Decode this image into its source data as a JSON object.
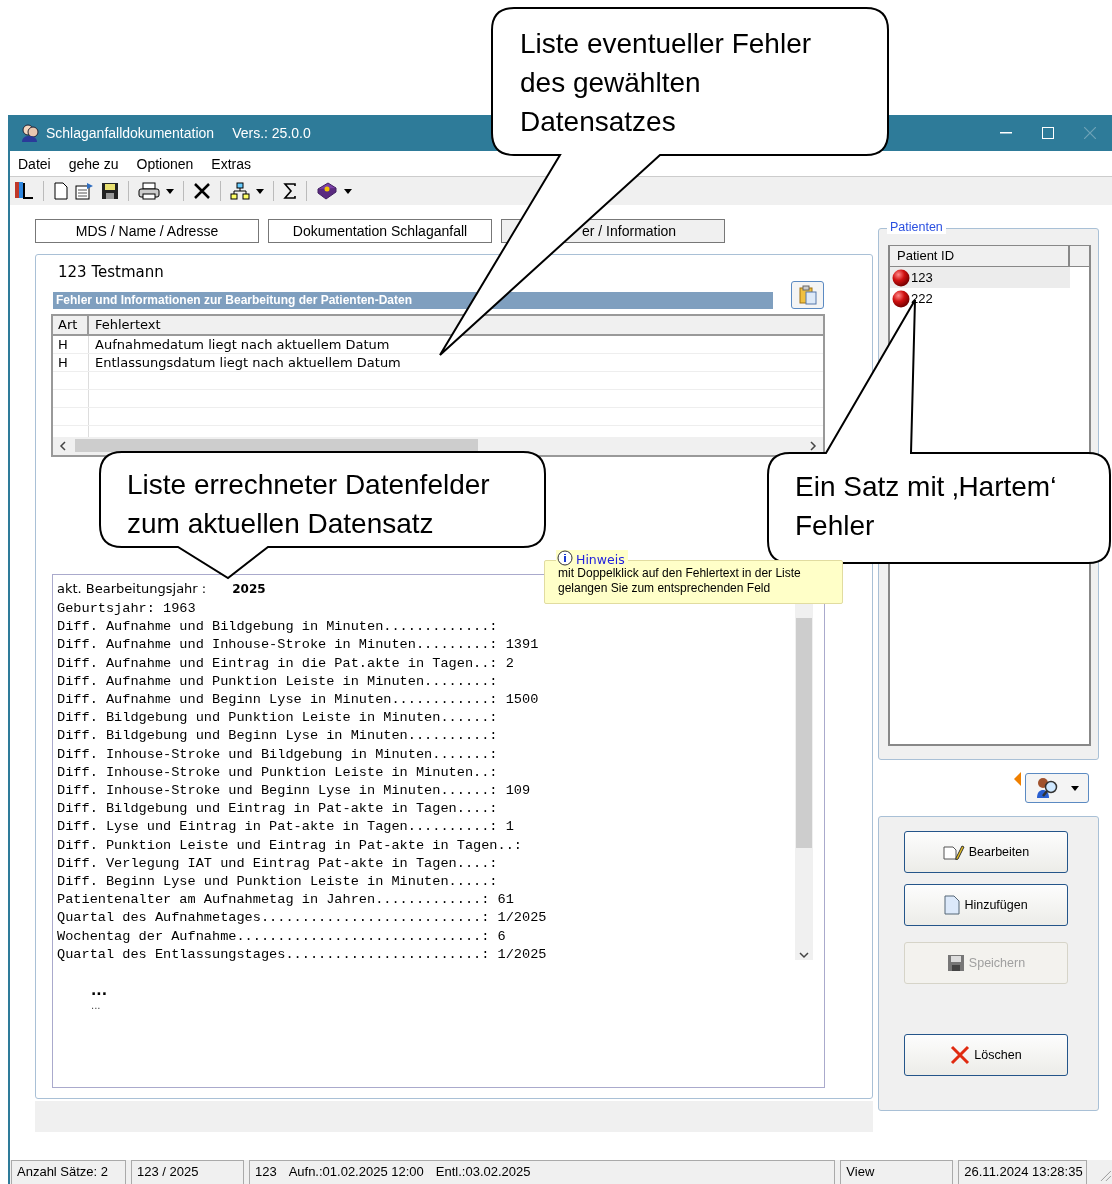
{
  "window": {
    "title": "Schlaganfalldokumentation",
    "version": "Vers.: 25.0.0"
  },
  "menu": [
    "Datei",
    "gehe zu",
    "Optionen",
    "Extras"
  ],
  "tabs": [
    {
      "label": "MDS / Name / Adresse",
      "selected": false
    },
    {
      "label": "Dokumentation Schlaganfall",
      "selected": false
    },
    {
      "label": "er / Information",
      "selected": false
    }
  ],
  "patient_header": "123 Testmann",
  "errors": {
    "title": "Fehler und Informationen zur Bearbeitung der Patienten-Daten",
    "columns": [
      "Art",
      "Fehlertext"
    ],
    "rows": [
      [
        "H",
        "Aufnahmedatum liegt nach aktuellem Datum"
      ],
      [
        "H",
        "Entlassungsdatum liegt nach aktuellem Datum"
      ]
    ]
  },
  "computed": {
    "year_label": "akt. Bearbeitungsjahr :",
    "year": "2025",
    "lines": [
      "Geburtsjahr: 1963",
      "Diff. Aufnahme und Bildgebung in Minuten.............:",
      "Diff. Aufnahme und Inhouse-Stroke in Minuten.........: 1391",
      "Diff. Aufnahme und Eintrag in die Pat.akte in Tagen..: 2",
      "Diff. Aufnahme und Punktion Leiste in Minuten........:",
      "Diff. Aufnahme und Beginn Lyse in Minuten............: 1500",
      "Diff. Bildgebung und Punktion Leiste in Minuten......:",
      "Diff. Bildgebung und Beginn Lyse in Minuten..........:",
      "Diff. Inhouse-Stroke und Bildgebung in Minuten.......:",
      "Diff. Inhouse-Stroke und Punktion Leiste in Minuten..:",
      "Diff. Inhouse-Stroke und Beginn Lyse in Minuten......: 109",
      "Diff. Bildgebung und Eintrag in Pat-akte in Tagen....:",
      "Diff. Lyse und Eintrag in Pat-akte in Tagen..........: 1",
      "Diff. Punktion Leiste und Eintrag in Pat-akte in Tagen..:",
      "Diff. Verlegung IAT und Eintrag Pat-akte in Tagen....:",
      "Diff. Beginn Lyse und Punktion Leiste in Minuten.....:",
      "Patientenalter am Aufnahmetag in Jahren.............: 61",
      "Quartal des Aufnahmetages...........................: 1/2025",
      "Wochentag der Aufnahme..............................: 6",
      "Quartal des Entlassungstages........................: 1/2025"
    ],
    "ellipsis_bold": "...",
    "ellipsis": "..."
  },
  "hint": {
    "title": "Hinweis",
    "text": "mit Doppelklick auf den Fehlertext in der Liste\ngelangen Sie zum entsprechenden Feld"
  },
  "patients": {
    "title": "Patienten",
    "column": "Patient ID",
    "rows": [
      {
        "id": "123",
        "selected": true
      },
      {
        "id": "222",
        "selected": false
      }
    ]
  },
  "actions": [
    {
      "label": "Bearbeiten",
      "kind": "edit",
      "disabled": false
    },
    {
      "label": "Hinzufügen",
      "kind": "add",
      "disabled": false
    },
    {
      "label": "Speichern",
      "kind": "save",
      "disabled": true
    },
    {
      "label": "Löschen",
      "kind": "delete",
      "disabled": false
    }
  ],
  "status_bar": [
    [
      "Anzahl Sätze: 2"
    ],
    [
      "123 / 2025"
    ],
    [
      "123",
      "Aufn.:01.02.2025 12:00",
      "Entl.:03.02.2025"
    ],
    [
      "View"
    ],
    [
      "26.11.2024 13:28:35"
    ]
  ],
  "callouts": [
    "Liste eventueller Fehler\ndes gewählten\nDatensatzes",
    "Liste errechneter Datenfelder\nzum aktuellen Datensatz",
    "Ein Satz mit ‚Hartem‘\nFehler"
  ]
}
